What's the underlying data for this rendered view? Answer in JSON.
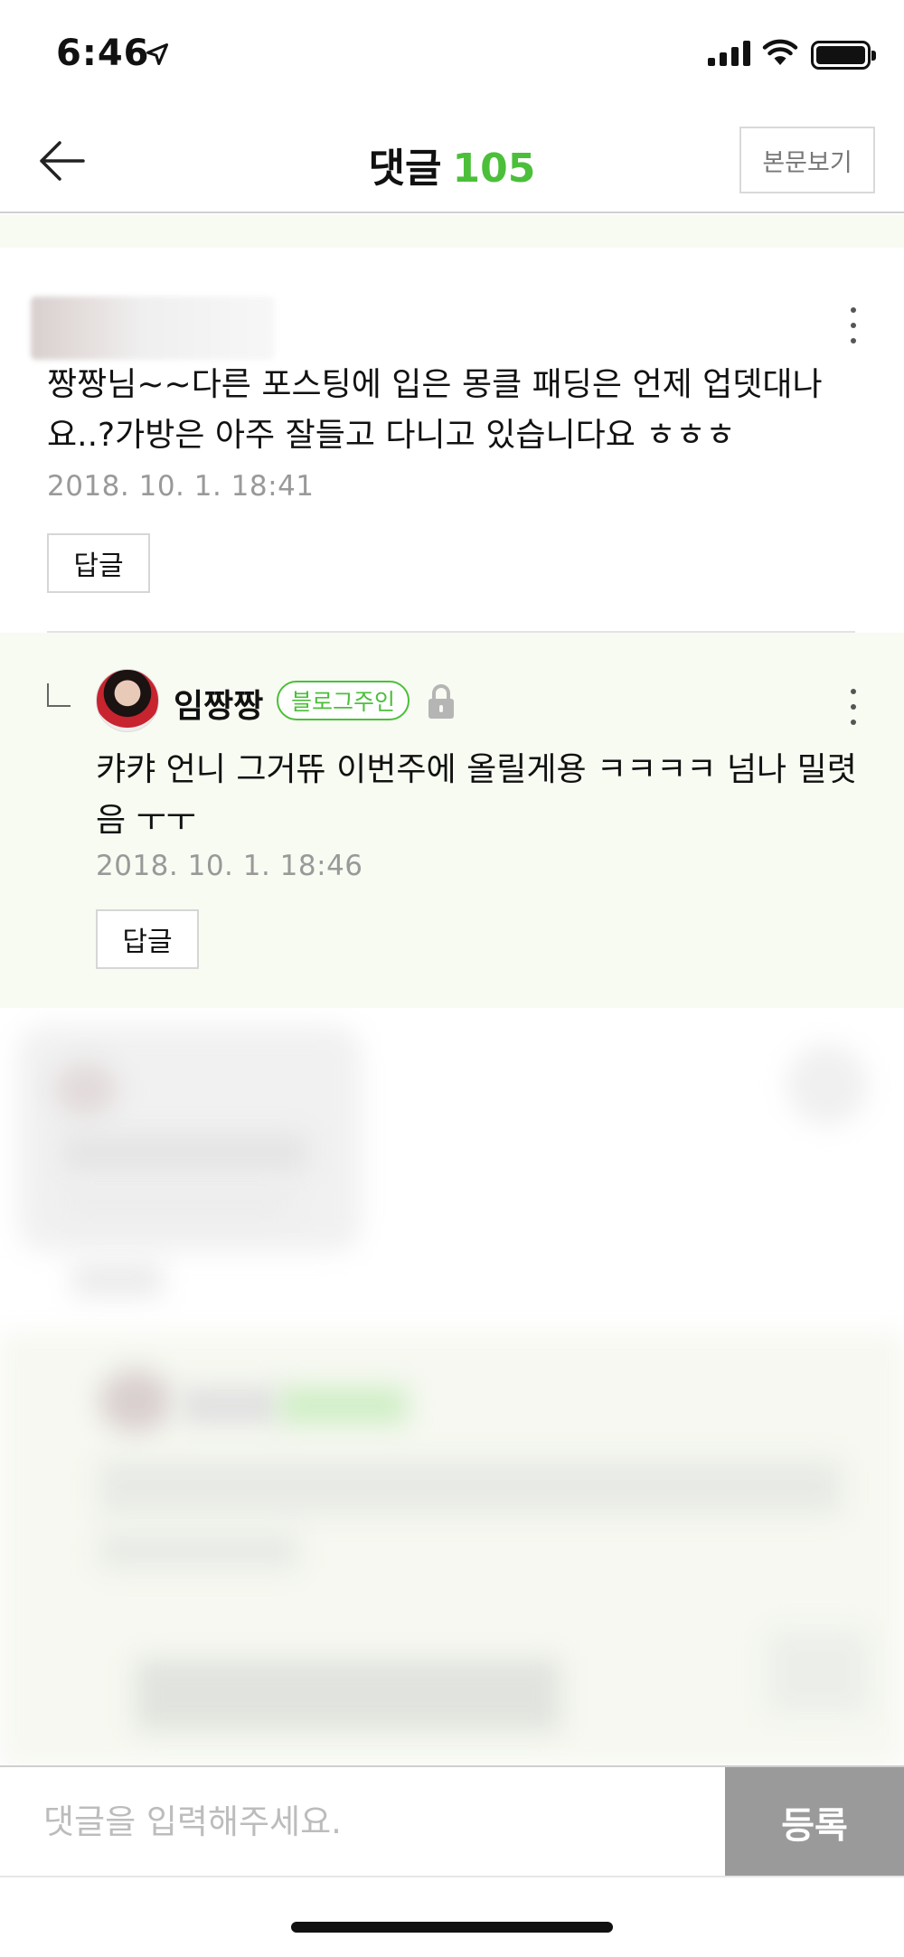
{
  "status_bar": {
    "time": "6:46"
  },
  "header": {
    "title": "댓글",
    "count": "105",
    "view_post_label": "본문보기"
  },
  "comments": [
    {
      "text": "짱짱님~~다른 포스팅에 입은 몽클 패딩은 언제 업뎃대나요..?가방은 아주 잘들고 다니고 있습니다요 ㅎㅎㅎ",
      "date": "2018. 10. 1. 18:41",
      "reply_label": "답글"
    }
  ],
  "owner_reply": {
    "author": "임짱짱",
    "badge": "블로그주인",
    "text": "캬캬 언니 그거뜌 이번주에 올릴게용 ㅋㅋㅋㅋ 넘나 밀렷음 ㅜㅜ",
    "date": "2018. 10. 1. 18:46",
    "reply_label": "답글"
  },
  "input": {
    "placeholder": "댓글을 입력해주세요.",
    "submit_label": "등록"
  },
  "colors": {
    "accent": "#4bbf3a",
    "reply_background": "#f8fbf2",
    "submit_background": "#9a9a9a"
  },
  "icons": [
    "back-arrow-icon",
    "location-arrow-icon",
    "signal-icon",
    "wifi-icon",
    "battery-icon",
    "more-icon",
    "reply-indent-icon",
    "lock-icon"
  ]
}
